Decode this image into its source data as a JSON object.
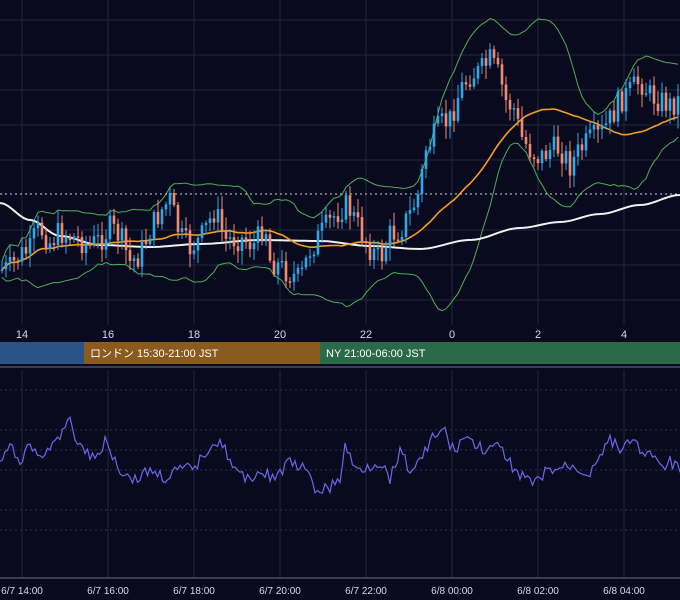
{
  "chart_data": [
    {
      "type": "candlestick",
      "panel": "price",
      "xlim": [
        13.5,
        5.5
      ],
      "x_ticks": [
        "14",
        "16",
        "18",
        "20",
        "22",
        "0",
        "2",
        "4"
      ],
      "colors": {
        "up": "#2ea8e6",
        "down": "#f08a73",
        "bollinger": "#4fae55",
        "ma_short": "#f0a020",
        "ma_long": "#f0f0f0",
        "ref_line": "#d0d0d0",
        "grid": "#22263d"
      },
      "sessions": [
        {
          "label": "",
          "color": "#2a5488"
        },
        {
          "label": "ロンドン 15:30-21:00 JST",
          "color": "#8a5a1e"
        },
        {
          "label": "NY 21:00-06:00 JST",
          "color": "#2a6a48"
        }
      ]
    },
    {
      "type": "line",
      "panel": "oscillator",
      "line_color": "#6a68e8",
      "x_ticks": [
        "6/7 14:00",
        "6/7 16:00",
        "6/7 18:00",
        "6/7 20:00",
        "6/7 22:00",
        "6/8 00:00",
        "6/8 02:00",
        "6/8 04:00"
      ]
    }
  ]
}
